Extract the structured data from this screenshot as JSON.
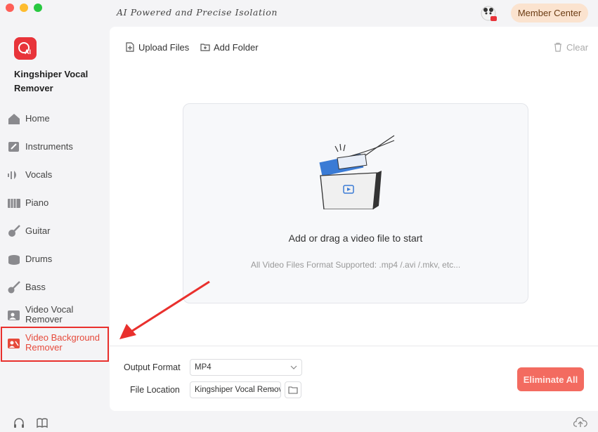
{
  "titlebar": {
    "tagline": "AI Powered and Precise Isolation",
    "member_label": "Member Center"
  },
  "sidebar": {
    "app_name": "Kingshiper Vocal Remover",
    "items": [
      {
        "label": "Home",
        "icon": "home-icon"
      },
      {
        "label": "Instruments",
        "icon": "instruments-icon"
      },
      {
        "label": "Vocals",
        "icon": "vocals-icon"
      },
      {
        "label": "Piano",
        "icon": "piano-icon"
      },
      {
        "label": "Guitar",
        "icon": "guitar-icon"
      },
      {
        "label": "Drums",
        "icon": "drums-icon"
      },
      {
        "label": "Bass",
        "icon": "bass-icon"
      },
      {
        "label": "Video Vocal Remover",
        "icon": "video-vocal-icon"
      },
      {
        "label": "Video Background Remover",
        "icon": "video-background-icon",
        "active": true
      }
    ]
  },
  "toolbar": {
    "upload_label": "Upload Files",
    "add_folder_label": "Add Folder",
    "clear_label": "Clear"
  },
  "dropzone": {
    "title": "Add or drag a video file to start",
    "subtitle": "All Video Files Format Supported: .mp4 /.avi /.mkv, etc..."
  },
  "output": {
    "format_label": "Output Format",
    "format_value": "MP4",
    "location_label": "File Location",
    "location_value": "Kingshiper Vocal Remover"
  },
  "actions": {
    "eliminate_label": "Eliminate All"
  },
  "colors": {
    "accent": "#e9302d",
    "button": "#f36b60",
    "member_bg": "#fbe3cf"
  }
}
